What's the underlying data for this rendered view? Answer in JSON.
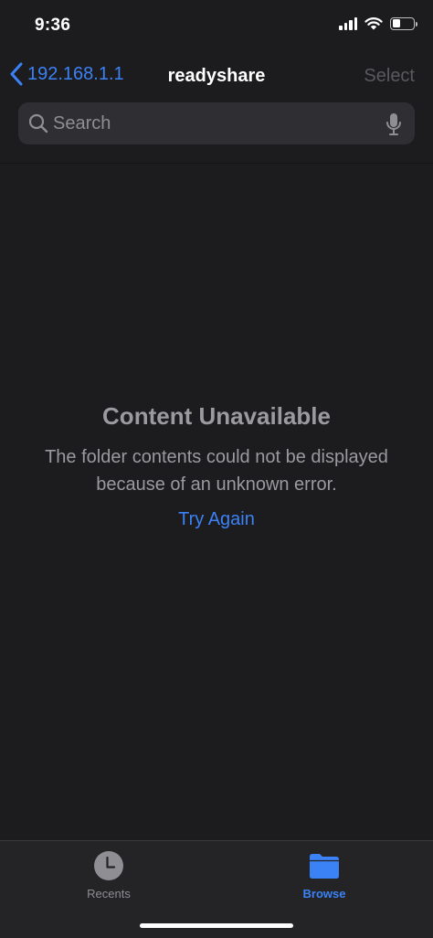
{
  "status_bar": {
    "time": "9:36",
    "battery_level": 0.4
  },
  "nav": {
    "back_label": "192.168.1.1",
    "title": "readyshare",
    "select_label": "Select"
  },
  "search": {
    "placeholder": "Search",
    "value": ""
  },
  "empty_state": {
    "title": "Content Unavailable",
    "message": "The folder contents could not be displayed because of an unknown error.",
    "action_label": "Try Again"
  },
  "tab_bar": {
    "items": [
      {
        "label": "Recents",
        "icon": "clock-icon",
        "selected": false
      },
      {
        "label": "Browse",
        "icon": "folder-icon",
        "selected": true
      }
    ]
  },
  "colors": {
    "background": "#1c1c1e",
    "accent": "#3b82f6",
    "secondary_text": "#9a9a9f",
    "disabled_text": "#5a5a5e",
    "search_field": "#2f2f33",
    "tab_bar": "#242426"
  }
}
